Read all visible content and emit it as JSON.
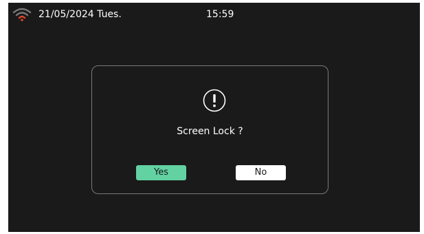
{
  "status_bar": {
    "date": "21/05/2024 Tues.",
    "time": "15:59",
    "wifi_icon": "wifi-icon"
  },
  "dialog": {
    "icon": "exclamation-circle-icon",
    "message": "Screen Lock ?",
    "yes_label": "Yes",
    "no_label": "No"
  },
  "colors": {
    "background": "#1a1a1a",
    "yes_button": "#62d2a2",
    "no_button": "#ffffff",
    "wifi_active": "#d9442c",
    "wifi_inactive": "#7a7a7a",
    "dialog_border": "#7a7a7a"
  }
}
